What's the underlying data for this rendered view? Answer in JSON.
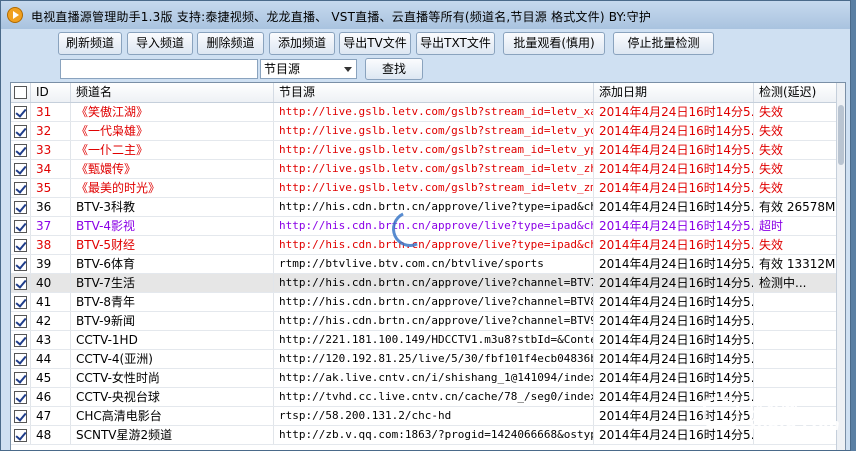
{
  "window": {
    "title": "电视直播源管理助手1.3版  支持:泰捷视频、龙龙直播、 VST直播、云直播等所有(频道名,节目源  格式文件) BY:守护"
  },
  "toolbar": {
    "refresh": "刷新频道",
    "import": "导入频道",
    "delete": "删除频道",
    "add": "添加频道",
    "export_tv": "导出TV文件",
    "export_txt": "导出TXT文件",
    "batch_watch": "批量观看(慎用)",
    "stop_check": "停止批量检测"
  },
  "search": {
    "value": "",
    "field": "节目源",
    "button": "查找"
  },
  "table": {
    "headers": {
      "id": "ID",
      "name": "频道名",
      "source": "节目源",
      "date": "添加日期",
      "check": "检测(延迟)"
    },
    "rows": [
      {
        "id": "31",
        "name": "《笑傲江湖》",
        "source": "http://live.gslb.letv.com/gslb?stream_id=letv_xa…",
        "date": "2014年4月24日16时14分5…",
        "check": "失效",
        "color": "#e00000"
      },
      {
        "id": "32",
        "name": "《一代枭雄》",
        "source": "http://live.gslb.letv.com/gslb?stream_id=letv_yd…",
        "date": "2014年4月24日16时14分5…",
        "check": "失效",
        "color": "#e00000"
      },
      {
        "id": "33",
        "name": "《一仆二主》",
        "source": "http://live.gslb.letv.com/gslb?stream_id=letv_yp…",
        "date": "2014年4月24日16时14分5…",
        "check": "失效",
        "color": "#e00000"
      },
      {
        "id": "34",
        "name": "《甄嬛传》",
        "source": "http://live.gslb.letv.com/gslb?stream_id=letv_zh…",
        "date": "2014年4月24日16时14分5…",
        "check": "失效",
        "color": "#e00000"
      },
      {
        "id": "35",
        "name": "《最美的时光》",
        "source": "http://live.gslb.letv.com/gslb?stream_id=letv_zm…",
        "date": "2014年4月24日16时14分5…",
        "check": "失效",
        "color": "#e00000"
      },
      {
        "id": "36",
        "name": "BTV-3科教",
        "source": "http://his.cdn.brtn.cn/approve/live?type=ipad&ch…",
        "date": "2014年4月24日16时14分5…",
        "check": "有效  26578Ms",
        "color": "#000000"
      },
      {
        "id": "37",
        "name": "BTV-4影视",
        "source": "http://his.cdn.brtn.cn/approve/live?type=ipad&ch…",
        "date": "2014年4月24日16时14分5…",
        "check": "超时",
        "color": "#8a00e6"
      },
      {
        "id": "38",
        "name": "BTV-5财经",
        "source": "http://his.cdn.brtn.cn/approve/live?type=ipad&ch…",
        "date": "2014年4月24日16时14分5…",
        "check": "失效",
        "color": "#e00000"
      },
      {
        "id": "39",
        "name": "BTV-6体育",
        "source": "rtmp://btvlive.btv.com.cn/btvlive/sports",
        "date": "2014年4月24日16时14分5…",
        "check": "有效  13312Ms",
        "color": "#000000"
      },
      {
        "id": "40",
        "name": "BTV-7生活",
        "source": "http://his.cdn.brtn.cn/approve/live?channel=BTV7…",
        "date": "2014年4月24日16时14分5…",
        "check": "检测中...",
        "color": "#000000",
        "selected": true
      },
      {
        "id": "41",
        "name": "BTV-8青年",
        "source": "http://his.cdn.brtn.cn/approve/live?channel=BTV8…",
        "date": "2014年4月24日16时14分5…",
        "check": "",
        "color": "#000000"
      },
      {
        "id": "42",
        "name": "BTV-9新闻",
        "source": "http://his.cdn.brtn.cn/approve/live?channel=BTV9…",
        "date": "2014年4月24日16时14分5…",
        "check": "",
        "color": "#000000"
      },
      {
        "id": "43",
        "name": "CCTV-1HD",
        "source": "http://221.181.100.149/HDCCTV1.m3u8?stbId=&Conte…",
        "date": "2014年4月24日16时14分5…",
        "check": "",
        "color": "#000000"
      },
      {
        "id": "44",
        "name": "CCTV-4(亚洲)",
        "source": "http://120.192.81.25/live/5/30/fbf101f4ecb04836b…",
        "date": "2014年4月24日16时14分5…",
        "check": "",
        "color": "#000000"
      },
      {
        "id": "45",
        "name": "CCTV-女性时尚",
        "source": "http://ak.live.cntv.cn/i/shishang_1@141094/index…",
        "date": "2014年4月24日16时14分5…",
        "check": "",
        "color": "#000000"
      },
      {
        "id": "46",
        "name": "CCTV-央视台球",
        "source": "http://tvhd.cc.live.cntv.cn/cache/78_/seg0/index…",
        "date": "2014年4月24日16时14分5…",
        "check": "",
        "color": "#000000"
      },
      {
        "id": "47",
        "name": "CHC高清电影台",
        "source": "rtsp://58.200.131.2/chc-hd",
        "date": "2014年4月24日16时14分5…",
        "check": "",
        "color": "#000000"
      },
      {
        "id": "48",
        "name": "SCNTV星游2频道",
        "source": "http://zb.v.qq.com:1863/?progid=1424066668&ostyp…",
        "date": "2014年4月24日16时14分5…",
        "check": "",
        "color": "#000000"
      }
    ]
  },
  "watermark": {
    "cn": "沙发网",
    "en": "Shafa.com"
  }
}
